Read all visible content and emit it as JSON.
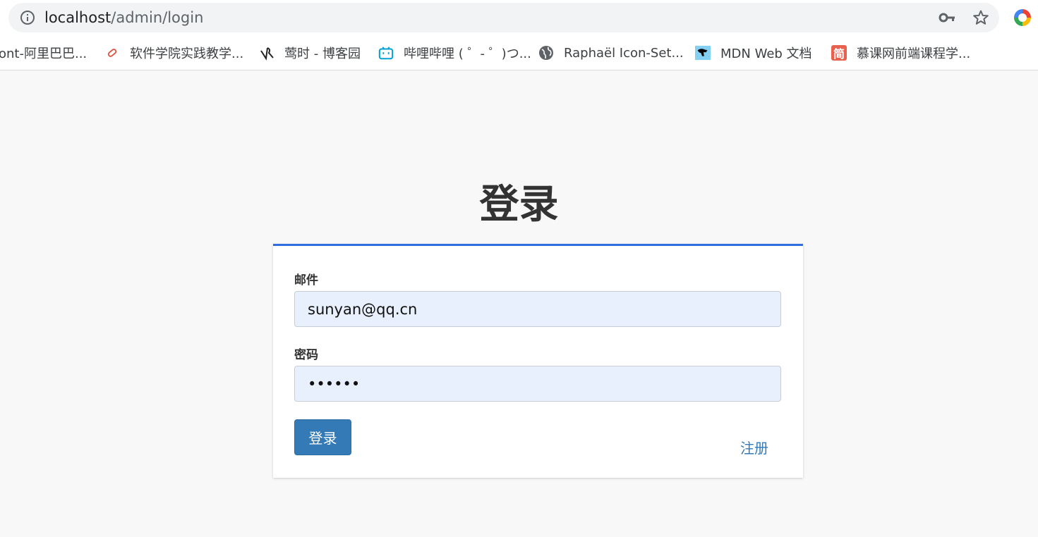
{
  "browser": {
    "url_host": "localhost",
    "url_path": "/admin/login",
    "bookmarks": [
      {
        "label": "ont-阿里巴巴...",
        "icon": "none"
      },
      {
        "label": "软件学院实践教学...",
        "icon": "link-icon"
      },
      {
        "label": "莺时 - 博客园",
        "icon": "blog-icon"
      },
      {
        "label": "哔哩哔哩 ( ゜- ゜)つ...",
        "icon": "bilibili-icon"
      },
      {
        "label": "Raphaël Icon-Set...",
        "icon": "globe-icon"
      },
      {
        "label": "MDN Web 文档",
        "icon": "mdn-icon"
      },
      {
        "label": "慕课网前端课程学...",
        "icon": "jian-icon",
        "icon_text": "简"
      }
    ]
  },
  "page": {
    "title": "登录"
  },
  "form": {
    "email_label": "邮件",
    "email_value": "sunyan@qq.cn",
    "password_label": "密码",
    "password_value": "••••••",
    "submit_label": "登录",
    "register_label": "注册"
  },
  "colors": {
    "accent": "#2f6de1",
    "button": "#337ab7",
    "autofill": "#e8f0fe"
  }
}
